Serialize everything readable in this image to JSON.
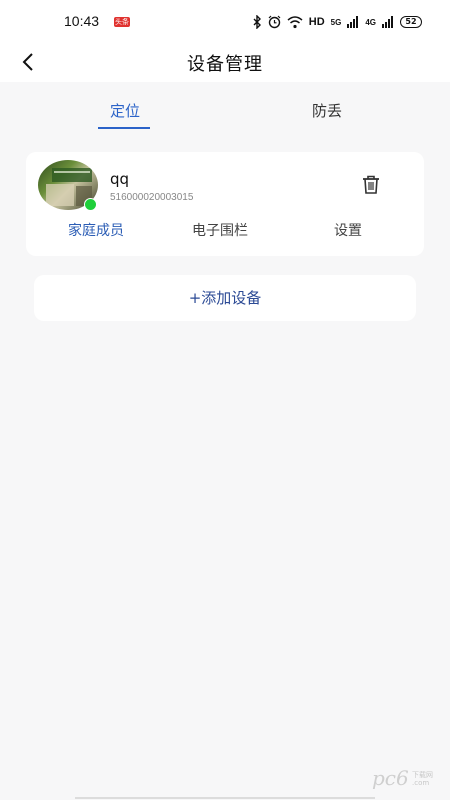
{
  "status_bar": {
    "time": "10:43",
    "badge": "头条",
    "network": "HD",
    "signal1": "5G",
    "signal2": "4G",
    "battery": "52"
  },
  "header": {
    "title": "设备管理"
  },
  "tabs": [
    {
      "label": "定位",
      "active": true
    },
    {
      "label": "防丢",
      "active": false
    }
  ],
  "device": {
    "name": "qq",
    "id": "516000020003015",
    "online": true,
    "actions": {
      "family": "家庭成员",
      "fence": "电子围栏",
      "settings": "设置"
    }
  },
  "add_device": {
    "label": "+添加设备"
  },
  "watermark": {
    "text": "pc6",
    "small": "下载网",
    "sub": ".com"
  },
  "colors": {
    "accent": "#2b63c9",
    "online": "#1fcf3a",
    "background": "#f7f7f8"
  }
}
